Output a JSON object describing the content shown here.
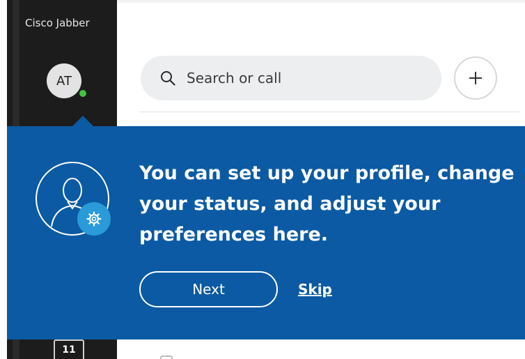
{
  "app": {
    "title": "Cisco Jabber"
  },
  "user": {
    "initials": "AT",
    "presence_color": "#42c342"
  },
  "search": {
    "placeholder": "Search or call",
    "icon": "search-icon"
  },
  "toolbar": {
    "add_icon": "plus-icon"
  },
  "coachmark": {
    "message": "You can set up your profile, change your status, and adjust your preferences here.",
    "next_label": "Next",
    "skip_label": "Skip",
    "illustration_icon": "user-profile-icon",
    "badge_icon": "gear-icon",
    "background_color": "#0b5aa3"
  },
  "sidebar": {
    "calendar_day": "11"
  },
  "colors": {
    "rail": "#1c1c1c",
    "accent": "#0b5aa3",
    "badge": "#2a9ad9"
  }
}
